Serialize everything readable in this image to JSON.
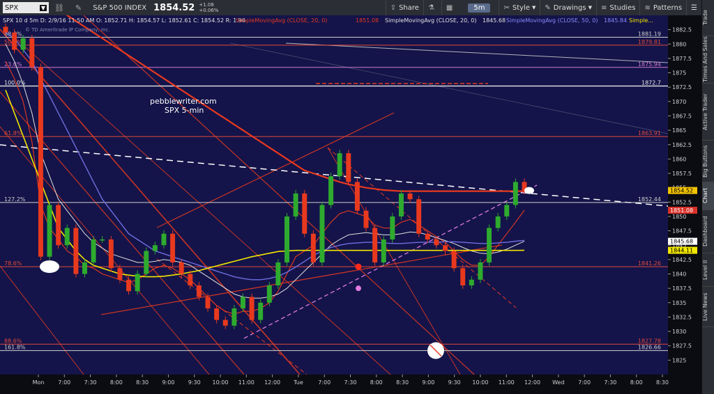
{
  "toolbar": {
    "symbol": "SPX",
    "index_name": "S&P 500 INDEX",
    "price": "1854.52",
    "change_abs": "+1.08",
    "change_pct": "+0.06%",
    "share": "Share",
    "aggregation": "5m",
    "style": "Style",
    "drawings": "Drawings",
    "studies": "Studies",
    "patterns": "Patterns"
  },
  "sidebar": [
    "Trade",
    "Times And Sales",
    "Active Trader",
    "Big Buttons",
    "Chart",
    "Dashboard",
    "Level II",
    "Live News"
  ],
  "info": {
    "line1": "SPX 10 d 5m  D: 2/9/16 11:50 AM  O: 1852.71  H: 1854.57  L: 1852.61  C: 1854.52  R: 1.96",
    "sma20": "SimpleMovingAvg (CLOSE, 20, 0)",
    "sma20_val": "1851.08",
    "sma20b": "SimpleMovingAvg (CLOSE, 20, 0)",
    "sma20b_val": "1845.68",
    "sma50": "SimpleMovingAvg (CLOSE, 50, 0)",
    "sma50_val": "1845.84",
    "more": "Simple...",
    "copyright": "© TD Ameritrade IP Company, Inc."
  },
  "annotation": {
    "line1": "pebblewriter.com",
    "line2": "SPX 5-min"
  },
  "chart_data": {
    "type": "line",
    "title": "pebblewriter.com SPX 5-min",
    "ylim": [
      1822.5,
      1885
    ],
    "y_ticks": [
      1825,
      1827.5,
      1830,
      1832.5,
      1835,
      1837.5,
      1840,
      1842.5,
      1845,
      1847.5,
      1850,
      1852.5,
      1855,
      1857.5,
      1860,
      1862.5,
      1865,
      1867.5,
      1870,
      1872.5,
      1875,
      1877.5,
      1880,
      1882.5
    ],
    "x_ticks": [
      "Mon",
      "7:00",
      "7:30",
      "8:00",
      "8:30",
      "9:00",
      "9:30",
      "10:00",
      "11:00",
      "12:00",
      "Tue",
      "7:00",
      "7:30",
      "8:00",
      "8:30",
      "9:00",
      "9:30",
      "10:00",
      "11:00",
      "12:00",
      "Wed",
      "7:00",
      "7:30",
      "8:00",
      "8:30"
    ],
    "fib_levels": [
      {
        "label": "88.6%",
        "value": 1881.19,
        "color": "#cfcfcf"
      },
      {
        "label": "50.0%",
        "value": 1879.81,
        "color": "#e04a3a"
      },
      {
        "label": "23.6%",
        "value": 1875.94,
        "color": "#d07ad0"
      },
      {
        "label": "100.0%",
        "value": 1872.7,
        "color": "#e8e8e8"
      },
      {
        "label": "61.8%",
        "value": 1863.91,
        "color": "#e04a3a"
      },
      {
        "label": "127.2%",
        "value": 1852.44,
        "color": "#cfcfcf"
      },
      {
        "label": "78.6%",
        "value": 1841.26,
        "color": "#e04a3a"
      },
      {
        "label": "88.6%",
        "value": 1827.78,
        "color": "#e04a3a"
      },
      {
        "label": "161.8%",
        "value": 1826.66,
        "color": "#cfcfcf"
      }
    ],
    "price_tags": [
      {
        "value": 1854.52,
        "bg": "#f2c300",
        "fg": "#000"
      },
      {
        "value": 1851.08,
        "bg": "#d9322a",
        "fg": "#fff"
      },
      {
        "value": 1845.68,
        "bg": "#ffffff",
        "fg": "#000"
      },
      {
        "value": 1844.11,
        "bg": "#f2e600",
        "fg": "#000"
      }
    ],
    "series": [
      {
        "name": "SPX",
        "values": [
          1882,
          1879,
          1881,
          1876,
          1843,
          1852,
          1845,
          1848,
          1840,
          1842,
          1846,
          1846,
          1841,
          1839,
          1837,
          1840,
          1844,
          1845,
          1847,
          1842,
          1840,
          1838,
          1836,
          1834,
          1832,
          1831,
          1834,
          1836,
          1832,
          1835,
          1838,
          1842,
          1850,
          1854,
          1847,
          1842,
          1852,
          1857,
          1861,
          1856,
          1851,
          1848,
          1842,
          1846,
          1850,
          1854,
          1853,
          1847,
          1846,
          1845,
          1844,
          1841,
          1838,
          1839,
          1842,
          1848,
          1850,
          1852,
          1856,
          1854.52
        ]
      },
      {
        "name": "SMA 20",
        "values": [
          1877,
          1874,
          1870,
          1863,
          1852,
          1848,
          1846,
          1844,
          1843,
          1841.5,
          1841,
          1840,
          1839.5,
          1839,
          1838.5,
          1839,
          1840,
          1841,
          1841.5,
          1841,
          1840,
          1839,
          1837.5,
          1836,
          1834.5,
          1833.5,
          1833,
          1833.5,
          1833.5,
          1834,
          1835,
          1837,
          1840,
          1843,
          1844,
          1845,
          1847,
          1849,
          1850.5,
          1851,
          1850.5,
          1850,
          1848.5,
          1848,
          1848,
          1849,
          1849.5,
          1848.5,
          1847.5,
          1846.5,
          1845.5,
          1844,
          1842.5,
          1841.5,
          1841.5,
          1843,
          1845,
          1847,
          1849,
          1851.08
        ]
      },
      {
        "name": "SMA 20",
        "values": [
          1880,
          1877,
          1873,
          1868,
          1861,
          1857,
          1853,
          1851,
          1849,
          1847,
          1845.5,
          1844.5,
          1843.5,
          1843,
          1842.5,
          1842,
          1842,
          1842.2,
          1842.5,
          1842.3,
          1842,
          1841.5,
          1840.5,
          1839.5,
          1838.5,
          1837.5,
          1836.5,
          1836,
          1835.8,
          1835.8,
          1836,
          1836.5,
          1837.5,
          1839,
          1840.5,
          1842,
          1843.5,
          1845,
          1846,
          1846.8,
          1847,
          1847.2,
          1847,
          1846.8,
          1846.8,
          1847,
          1847.3,
          1847.2,
          1846.8,
          1846.3,
          1845.8,
          1845.3,
          1844.6,
          1844,
          1843.6,
          1843.5,
          1843.8,
          1844.3,
          1845,
          1845.68
        ]
      },
      {
        "name": "SMA 50",
        "values": [
          1882,
          1881,
          1879,
          1877,
          1874,
          1871,
          1868,
          1865,
          1862,
          1859,
          1856,
          1853,
          1851,
          1849,
          1847,
          1846,
          1845,
          1844,
          1843.5,
          1843,
          1842.5,
          1842,
          1841.5,
          1841,
          1840.5,
          1840,
          1839.5,
          1839.2,
          1839,
          1839,
          1839.2,
          1839.6,
          1840.3,
          1841.2,
          1842.2,
          1843.2,
          1844,
          1844.6,
          1845,
          1845.3,
          1845.4,
          1845.5,
          1845.5,
          1845.4,
          1845.3,
          1845.3,
          1845.4,
          1845.5,
          1845.5,
          1845.5,
          1845.6,
          1845.6,
          1845.5,
          1845.4,
          1845.3,
          1845.3,
          1845.4,
          1845.5,
          1845.7,
          1845.84
        ]
      },
      {
        "name": "SMA 200",
        "values": [
          1892,
          1891,
          1890,
          1889,
          1888,
          1887,
          1886,
          1885,
          1884,
          1883,
          1882,
          1881,
          1880,
          1879,
          1878,
          1877,
          1876,
          1875,
          1874,
          1873,
          1872,
          1871,
          1870,
          1869,
          1868,
          1867,
          1866,
          1865,
          1864,
          1863,
          1862,
          1861,
          1860,
          1859,
          1858,
          1857.5,
          1857,
          1856.5,
          1856,
          1855.6,
          1855.3,
          1855,
          1854.8,
          1854.6,
          1854.5,
          1854.4,
          1854.4,
          1854.4,
          1854.4,
          1854.4,
          1854.4,
          1854.4,
          1854.4,
          1854.4,
          1854.4,
          1854.4,
          1854.4,
          1854.4,
          1854.4,
          1854.4
        ]
      },
      {
        "name": "SMA 100",
        "values": [
          1872,
          1868,
          1864,
          1860,
          1856,
          1852,
          1848,
          1846,
          1844,
          1842.5,
          1841.5,
          1841,
          1840.5,
          1840,
          1839.8,
          1839.6,
          1839.5,
          1839.5,
          1839.6,
          1839.8,
          1840,
          1840.3,
          1840.6,
          1841,
          1841.4,
          1841.8,
          1842.2,
          1842.6,
          1843,
          1843.3,
          1843.6,
          1843.9,
          1844,
          1844.1,
          1844.1,
          1844.1,
          1844.1,
          1844.1,
          1844.1,
          1844.1,
          1844.1,
          1844.1,
          1844.1,
          1844.1,
          1844.1,
          1844.1,
          1844.1,
          1844.1,
          1844.1,
          1844.1,
          1844.1,
          1844.1,
          1844.1,
          1844.1,
          1844.1,
          1844.1,
          1844.1,
          1844.1,
          1844.1,
          1844.11
        ]
      }
    ]
  },
  "colors": {
    "background": "#14144a",
    "up": "#2eab2e",
    "down": "#e8391e",
    "sma_red": "#e8391e",
    "sma_white": "#e0e0e0",
    "sma_blue": "#6e6ee0",
    "sma_yellow": "#f2e600"
  }
}
